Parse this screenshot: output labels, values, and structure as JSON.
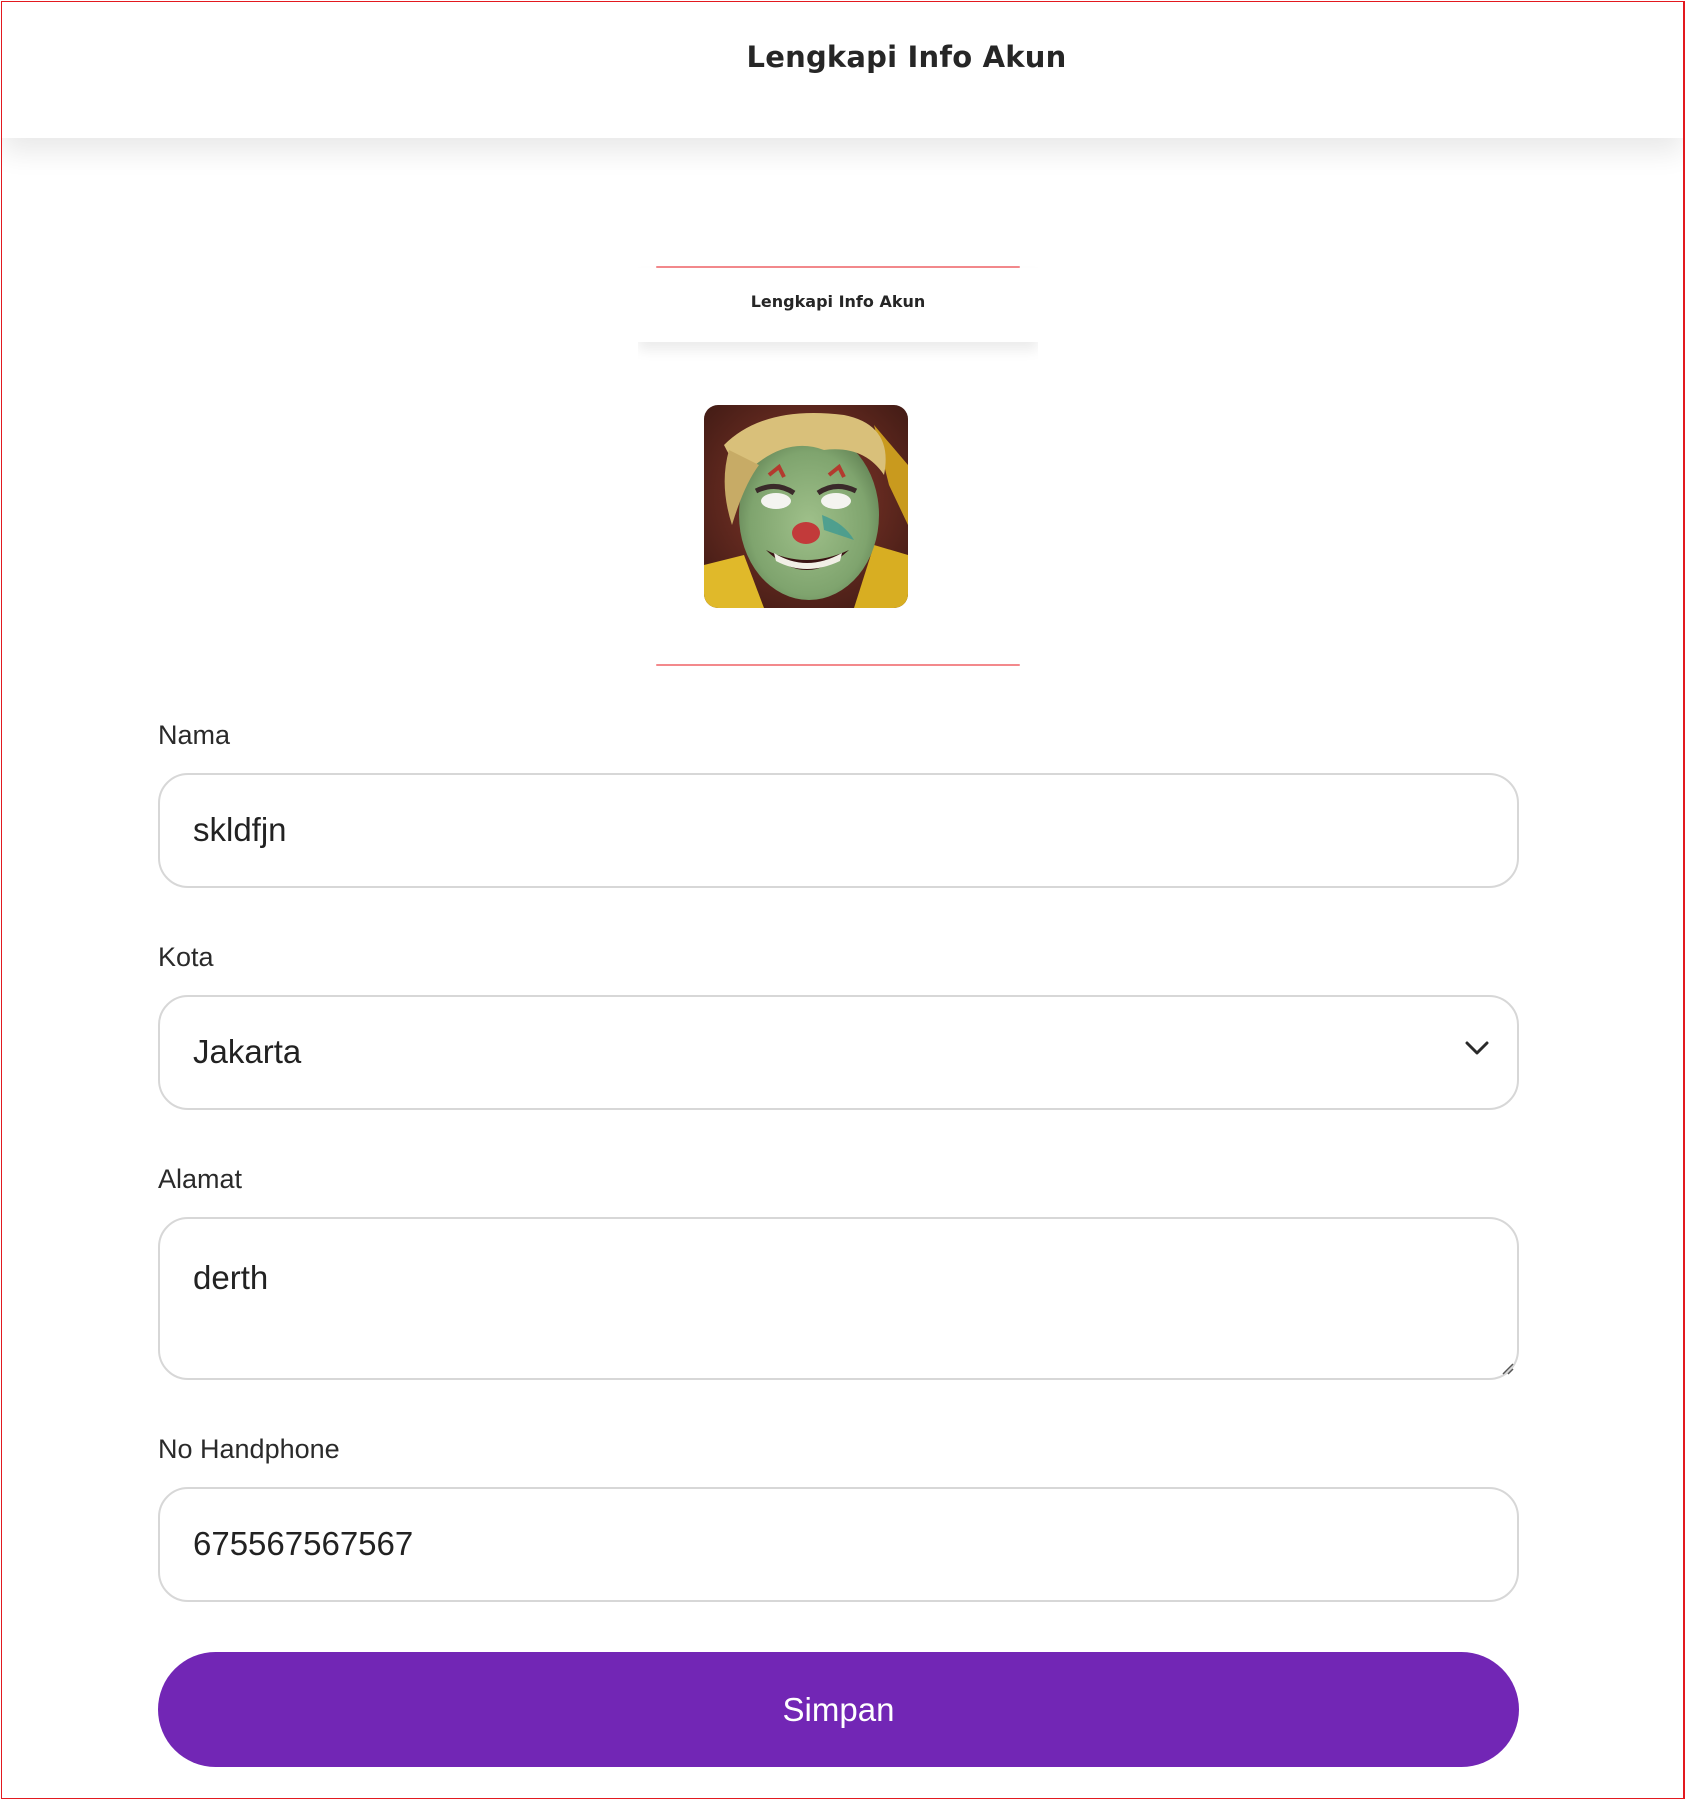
{
  "header": {
    "title": "Lengkapi Info Akun"
  },
  "preview": {
    "title": "Lengkapi Info Akun",
    "avatar_icon": "avatar-image"
  },
  "form": {
    "nama": {
      "label": "Nama",
      "value": "skldfjn"
    },
    "kota": {
      "label": "Kota",
      "selected": "Jakarta",
      "icon": "chevron-down-icon"
    },
    "alamat": {
      "label": "Alamat",
      "value": "derth"
    },
    "handphone": {
      "label": "No Handphone",
      "value": "675567567567"
    },
    "submit_label": "Simpan"
  },
  "colors": {
    "accent": "#7226b5",
    "frame_border": "#e3191f",
    "input_border": "#d7d7d7"
  }
}
